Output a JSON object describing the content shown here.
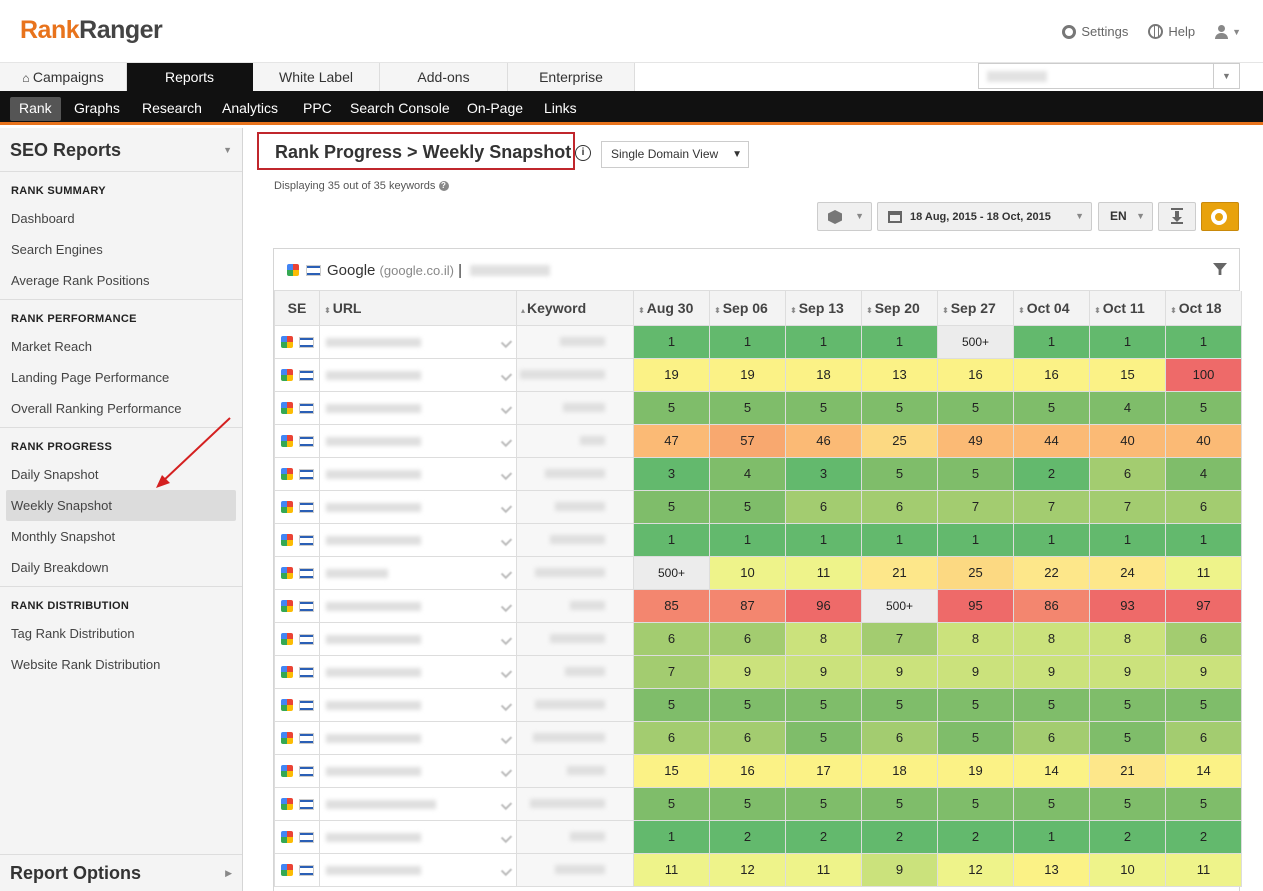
{
  "brand": {
    "part1": "Rank",
    "part2": "Ranger"
  },
  "toplinks": {
    "settings": "Settings",
    "help": "Help"
  },
  "tabs": [
    {
      "label": "Campaigns"
    },
    {
      "label": "Reports"
    },
    {
      "label": "White Label"
    },
    {
      "label": "Add-ons"
    },
    {
      "label": "Enterprise"
    }
  ],
  "subnav": [
    "Rank",
    "Graphs",
    "Research",
    "Analytics",
    "PPC",
    "Search Console",
    "On-Page",
    "Links"
  ],
  "sidebar": {
    "title": "SEO Reports",
    "sections": [
      {
        "title": "RANK SUMMARY",
        "items": [
          "Dashboard",
          "Search Engines",
          "Average Rank Positions"
        ]
      },
      {
        "title": "RANK PERFORMANCE",
        "items": [
          "Market Reach",
          "Landing Page Performance",
          "Overall Ranking Performance"
        ]
      },
      {
        "title": "RANK PROGRESS",
        "items": [
          "Daily Snapshot",
          "Weekly Snapshot",
          "Monthly Snapshot",
          "Daily Breakdown"
        ]
      },
      {
        "title": "RANK DISTRIBUTION",
        "items": [
          "Tag Rank Distribution",
          "Website Rank Distribution"
        ]
      }
    ],
    "active": "Weekly Snapshot",
    "footer": "Report Options"
  },
  "page": {
    "title": "Rank Progress > Weekly Snapshot",
    "view": "Single Domain View",
    "displaying": "Displaying 35 out of 35 keywords",
    "date_range": "18 Aug, 2015 - 18 Oct, 2015",
    "language": "EN"
  },
  "panel": {
    "engine": "Google",
    "domain": "(google.co.il)",
    "sep": "|"
  },
  "table": {
    "headers": {
      "se": "SE",
      "url": "URL",
      "keyword": "Keyword"
    },
    "dates": [
      "Aug 30",
      "Sep 06",
      "Sep 13",
      "Sep 20",
      "Sep 27",
      "Oct 04",
      "Oct 11",
      "Oct 18"
    ],
    "rows": [
      [
        "1",
        "1",
        "1",
        "1",
        "500+",
        "1",
        "1",
        "1"
      ],
      [
        "19",
        "19",
        "18",
        "13",
        "16",
        "16",
        "15",
        "100"
      ],
      [
        "5",
        "5",
        "5",
        "5",
        "5",
        "5",
        "4",
        "5"
      ],
      [
        "47",
        "57",
        "46",
        "25",
        "49",
        "44",
        "40",
        "40"
      ],
      [
        "3",
        "4",
        "3",
        "5",
        "5",
        "2",
        "6",
        "4"
      ],
      [
        "5",
        "5",
        "6",
        "6",
        "7",
        "7",
        "7",
        "6"
      ],
      [
        "1",
        "1",
        "1",
        "1",
        "1",
        "1",
        "1",
        "1"
      ],
      [
        "500+",
        "10",
        "11",
        "21",
        "25",
        "22",
        "24",
        "11"
      ],
      [
        "85",
        "87",
        "96",
        "500+",
        "95",
        "86",
        "93",
        "97"
      ],
      [
        "6",
        "6",
        "8",
        "7",
        "8",
        "8",
        "8",
        "6"
      ],
      [
        "7",
        "9",
        "9",
        "9",
        "9",
        "9",
        "9",
        "9"
      ],
      [
        "5",
        "5",
        "5",
        "5",
        "5",
        "5",
        "5",
        "5"
      ],
      [
        "6",
        "6",
        "5",
        "6",
        "5",
        "6",
        "5",
        "6"
      ],
      [
        "15",
        "16",
        "17",
        "18",
        "19",
        "14",
        "21",
        "14"
      ],
      [
        "5",
        "5",
        "5",
        "5",
        "5",
        "5",
        "5",
        "5"
      ],
      [
        "1",
        "2",
        "2",
        "2",
        "2",
        "1",
        "2",
        "2"
      ],
      [
        "11",
        "12",
        "11",
        "9",
        "12",
        "13",
        "10",
        "11"
      ]
    ]
  },
  "colors": {
    "accent": "#e8731c",
    "highlight_box": "#c0262c",
    "settings_button": "#e8a20c"
  }
}
